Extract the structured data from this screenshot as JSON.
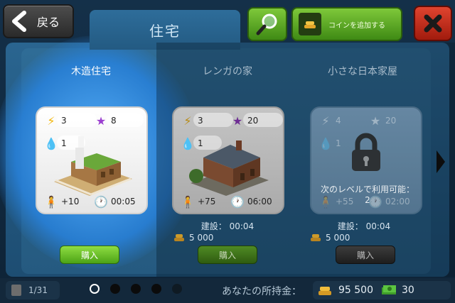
{
  "header": {
    "back_label": "戻る",
    "title": "住宅",
    "add_coins_label": "コインを追加する"
  },
  "items": [
    {
      "name": "木造住宅",
      "energy": "3",
      "stars": "8",
      "water": "1",
      "population": "+10",
      "time": "00:05",
      "buy_label": "購入",
      "state": "selected"
    },
    {
      "name": "レンガの家",
      "energy": "3",
      "stars": "20",
      "water": "1",
      "population": "+75",
      "time": "06:00",
      "build_time": "建設： 00:04",
      "price": "5 000",
      "buy_label": "購入",
      "state": "available"
    },
    {
      "name": "小さな日本家屋",
      "energy": "4",
      "stars": "20",
      "water": "1",
      "population": "+55",
      "time": "02:00",
      "locked_text": "次のレベルで利用可能：",
      "locked_level": "2",
      "build_time": "建設： 00:04",
      "price": "5 000",
      "buy_label": "購入",
      "state": "locked"
    }
  ],
  "footer": {
    "page": "1/31",
    "wealth_label": "あなたの所持金：",
    "coins": "95 500",
    "cash": "30",
    "page_dots": 5,
    "active_dot": 0
  },
  "colors": {
    "accent_green": "#5fb423",
    "close_red": "#c42a18",
    "panel_blue": "#2a6590"
  }
}
